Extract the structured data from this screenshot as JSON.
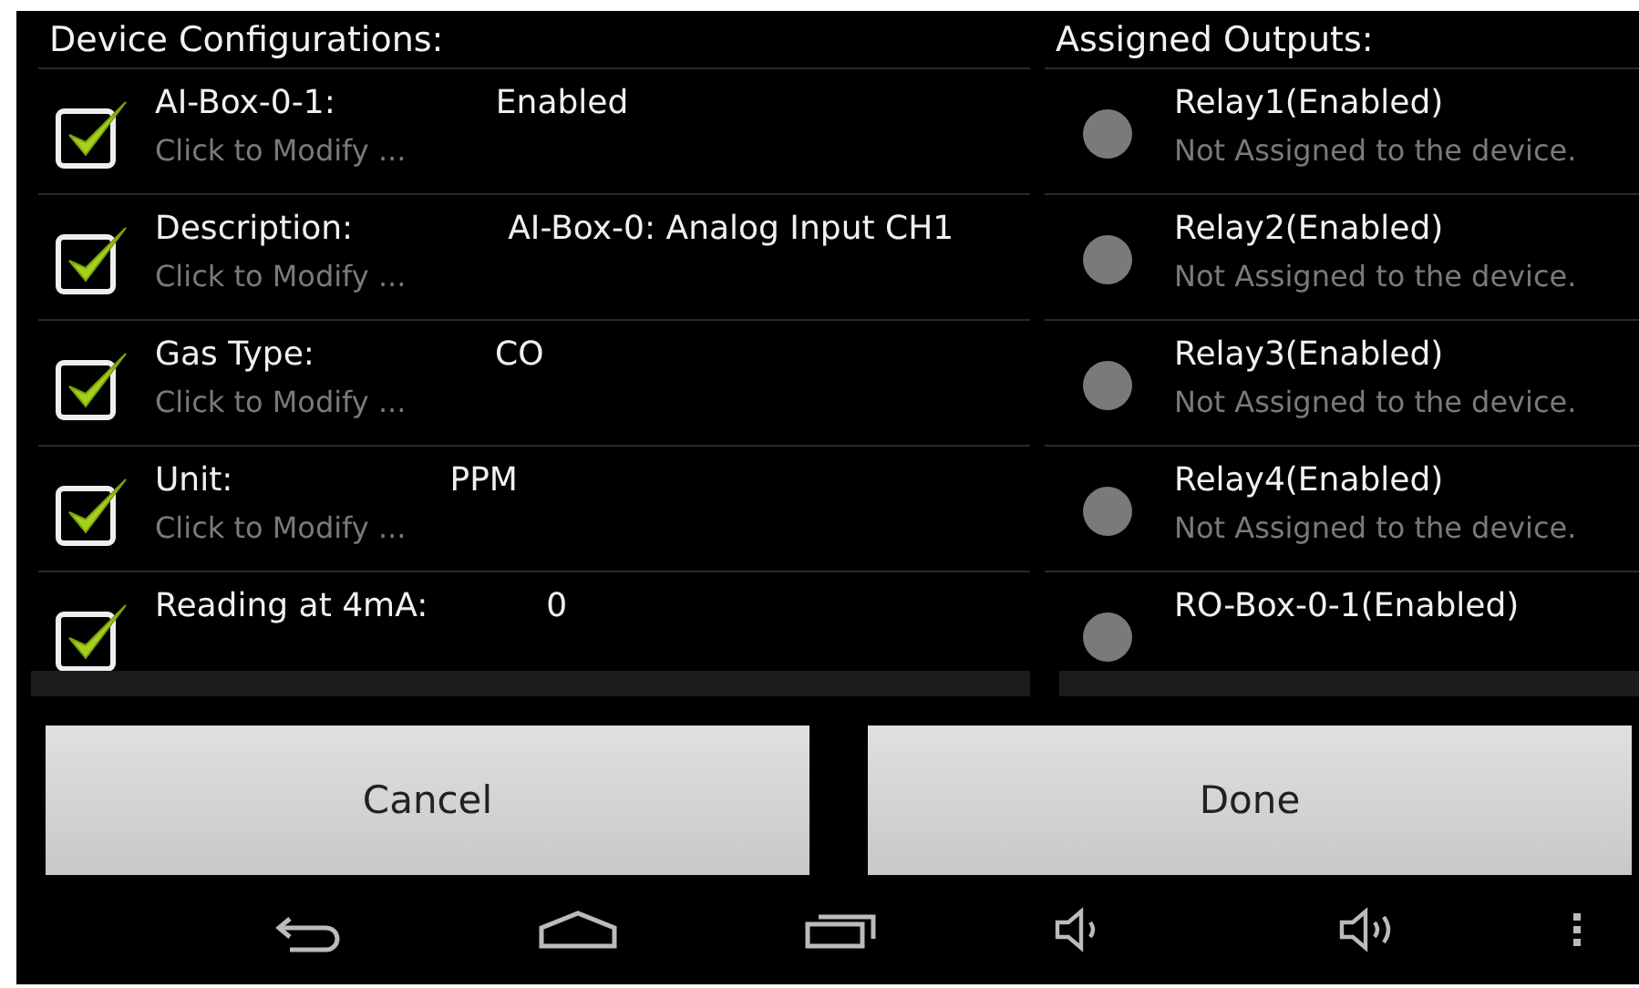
{
  "device_panel": {
    "title": "Device Configurations:",
    "items": [
      {
        "label": "AI-Box-0-1:",
        "value": "Enabled",
        "hint": "Click to Modify ...",
        "checked": true
      },
      {
        "label": "Description:",
        "value": "AI-Box-0: Analog Input CH1",
        "hint": "Click to Modify ...",
        "checked": true
      },
      {
        "label": "Gas Type:",
        "value": "CO",
        "hint": "Click to Modify ...",
        "checked": true
      },
      {
        "label": "Unit:",
        "value": "PPM",
        "hint": "Click to Modify ...",
        "checked": true
      },
      {
        "label": "Reading at 4mA:",
        "value": "0",
        "checked": true
      }
    ]
  },
  "outputs_panel": {
    "title": "Assigned Outputs:",
    "items": [
      {
        "name": "Relay1(Enabled)",
        "status": "Not Assigned to the device.",
        "assigned": false
      },
      {
        "name": "Relay2(Enabled)",
        "status": "Not Assigned to the device.",
        "assigned": false
      },
      {
        "name": "Relay3(Enabled)",
        "status": "Not Assigned to the device.",
        "assigned": false
      },
      {
        "name": "Relay4(Enabled)",
        "status": "Not Assigned to the device.",
        "assigned": false
      },
      {
        "name": "RO-Box-0-1(Enabled)",
        "assigned": false
      }
    ]
  },
  "buttons": [
    "Cancel",
    "Done"
  ]
}
